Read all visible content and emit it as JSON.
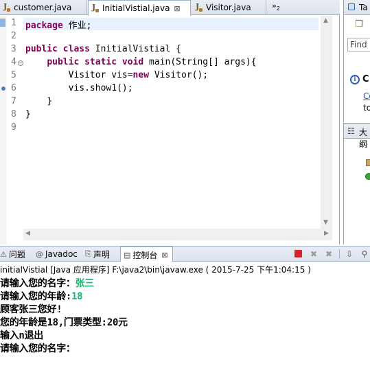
{
  "editor": {
    "tabs": [
      {
        "label": "customer.java"
      },
      {
        "label": "InitialVistial.java",
        "close": "⊠"
      },
      {
        "label": "Visitor.java"
      }
    ],
    "overflow": {
      "label": "»",
      "count": "2"
    },
    "line_numbers": [
      "1",
      "2",
      "3",
      "4",
      "5",
      "6",
      "7",
      "8",
      "9"
    ],
    "code": [
      {
        "kw": "package",
        "rest": " 作业;"
      },
      {
        "kw": "",
        "rest": ""
      },
      {
        "kw": "public class",
        "rest": " InitialVistial {"
      },
      {
        "indent": "    ",
        "kw": "public static void",
        "rest": " main(String[] args){"
      },
      {
        "indent": "        ",
        "pre": "Visitor vis=",
        "kw": "new",
        "rest": " Visitor();"
      },
      {
        "indent": "        ",
        "kw": "",
        "rest": "vis.show1();"
      },
      {
        "indent": "    ",
        "kw": "",
        "rest": "}"
      },
      {
        "kw": "",
        "rest": "}"
      },
      {
        "kw": "",
        "rest": ""
      }
    ]
  },
  "right_panel_top": {
    "header_label": "Ta",
    "find_placeholder": "Find",
    "info_label": "C",
    "link_label": "Co",
    "to_label": "to"
  },
  "right_panel_outline": {
    "header_label": "大纲"
  },
  "console": {
    "tabs": [
      {
        "label": "问题"
      },
      {
        "label": "Javadoc"
      },
      {
        "label": "声明"
      },
      {
        "label": "控制台",
        "close": "⊠"
      }
    ],
    "header": "initialVistial [Java 应用程序] F:\\java2\\bin\\javaw.exe ( 2015-7-25 下午1:04:15 )",
    "lines": [
      {
        "text": "请输入您的名字：",
        "input": "张三"
      },
      {
        "text": "请输入您的年龄:",
        "input": "18"
      },
      {
        "text": "顾客张三您好!",
        "input": ""
      },
      {
        "text": "您的年龄是18,门票类型:20元",
        "input": ""
      },
      {
        "text": "输入n退出",
        "input": ""
      },
      {
        "text": "请输入您的名字：",
        "input": ""
      }
    ],
    "colors": {
      "input": "#16b56c",
      "keyword": "#7f0055",
      "terminate": "#d6232a"
    }
  }
}
